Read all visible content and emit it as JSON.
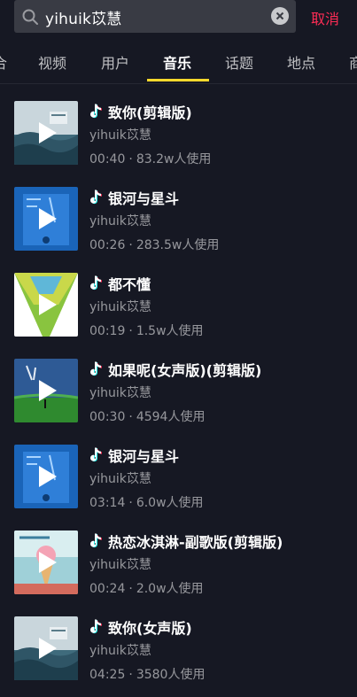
{
  "search": {
    "query": "yihuik苡慧",
    "cancel_label": "取消"
  },
  "tabs": [
    {
      "label": "合",
      "active": false
    },
    {
      "label": "视频",
      "active": false
    },
    {
      "label": "用户",
      "active": false
    },
    {
      "label": "音乐",
      "active": true
    },
    {
      "label": "话题",
      "active": false
    },
    {
      "label": "地点",
      "active": false
    },
    {
      "label": "商",
      "active": false
    }
  ],
  "colors": {
    "background": "#161823",
    "accent_red": "#fe2c55",
    "tab_indicator": "#fdd92c",
    "note_icon": "#25f4ee"
  },
  "songs": [
    {
      "title": "致你(剪辑版)",
      "artist": "yihuik苡慧",
      "duration": "00:40",
      "usage": "83.2w人使用",
      "cover": "sea"
    },
    {
      "title": "银河与星斗",
      "artist": "yihuik苡慧",
      "duration": "00:26",
      "usage": "283.5w人使用",
      "cover": "blue"
    },
    {
      "title": "都不懂",
      "artist": "yihuik苡慧",
      "duration": "00:19",
      "usage": "1.5w人使用",
      "cover": "green-triangle"
    },
    {
      "title": "如果呢(女声版)(剪辑版)",
      "artist": "yihuik苡慧",
      "duration": "00:30",
      "usage": "4594人使用",
      "cover": "field"
    },
    {
      "title": "银河与星斗",
      "artist": "yihuik苡慧",
      "duration": "03:14",
      "usage": "6.0w人使用",
      "cover": "blue"
    },
    {
      "title": "热恋冰淇淋-副歌版(剪辑版)",
      "artist": "yihuik苡慧",
      "duration": "00:24",
      "usage": "2.0w人使用",
      "cover": "icecream"
    },
    {
      "title": "致你(女声版)",
      "artist": "yihuik苡慧",
      "duration": "04:25",
      "usage": "3580人使用",
      "cover": "sea"
    }
  ],
  "separator": "·"
}
